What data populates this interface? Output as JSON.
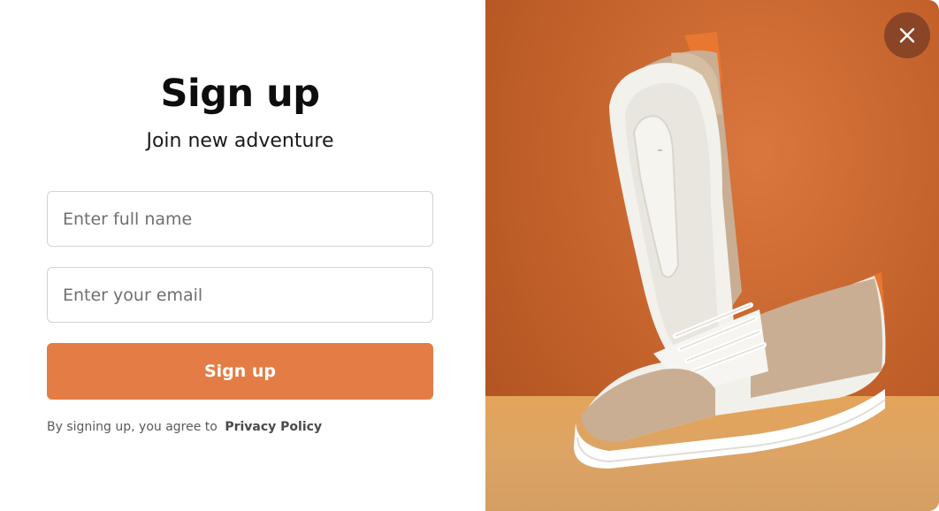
{
  "form": {
    "title": "Sign up",
    "subtitle": "Join new adventure",
    "name_placeholder": "Enter full name",
    "email_placeholder": "Enter your email",
    "submit_label": "Sign up",
    "terms_text": "By signing up, you agree to",
    "terms_link": "Privacy Policy"
  },
  "image": {
    "subject": "sneakers-photo",
    "background_color": "#c2602a",
    "floor_color": "#dca465"
  },
  "close_button": {
    "icon": "close-icon",
    "color": "#8a4526"
  },
  "colors": {
    "accent": "#e47c45",
    "title": "#0d0d0d"
  }
}
